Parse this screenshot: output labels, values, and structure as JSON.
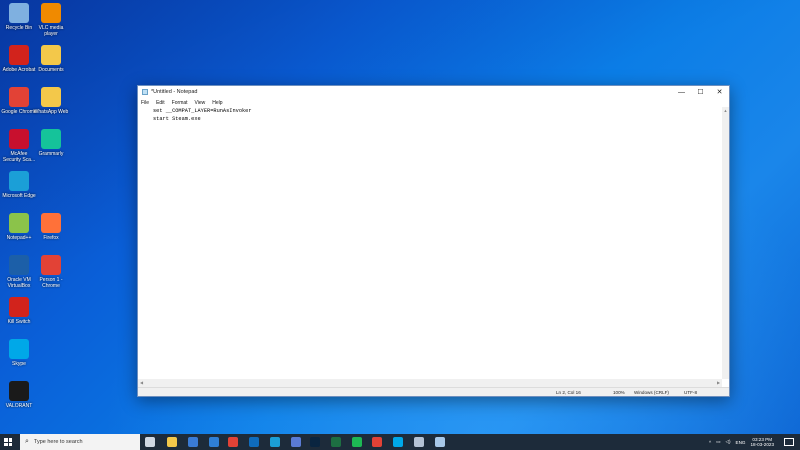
{
  "desktop": {
    "icons": [
      {
        "label": "Recycle Bin",
        "color": "#7fb0e0"
      },
      {
        "label": "VLC media player",
        "color": "#f08a00"
      },
      {
        "label": "Adobe Acrobat",
        "color": "#d2231c"
      },
      {
        "label": "Documents",
        "color": "#f3c84a"
      },
      {
        "label": "Google Chrome",
        "color": "#e24236"
      },
      {
        "label": "WhatsApp Web",
        "color": "#f3c84a"
      },
      {
        "label": "McAfee Security Sca...",
        "color": "#c8102e"
      },
      {
        "label": "Grammarly",
        "color": "#15c39a"
      },
      {
        "label": "Microsoft Edge",
        "color": "#1b9fd7"
      },
      {
        "label": "Notepad++",
        "color": "#8bc34a"
      },
      {
        "label": "Firefox",
        "color": "#ff7139"
      },
      {
        "label": "Oracle VM VirtualBox",
        "color": "#1c5fa8"
      },
      {
        "label": "Person 1 - Chrome",
        "color": "#e24236"
      },
      {
        "label": "Kill Switch",
        "color": "#d2231c"
      },
      {
        "label": "Skype",
        "color": "#00a8e8"
      },
      {
        "label": "VALORANT",
        "color": "#1a1a1a"
      }
    ]
  },
  "notepad": {
    "title": "*Untitled - Notepad",
    "controls": {
      "minimize": "—",
      "maximize": "☐",
      "close": "✕"
    },
    "menu": [
      "File",
      "Edit",
      "Format",
      "View",
      "Help"
    ],
    "content": "set __COMPAT_LAYER=RunAsInvoker\nstart Steam.exe",
    "status": {
      "position": "Ln 2, Col 16",
      "zoom": "100%",
      "line_ending": "Windows (CRLF)",
      "encoding": "UTF-8"
    }
  },
  "taskbar": {
    "search_placeholder": "Type here to search",
    "language": "ENG",
    "time": "03:23 PM",
    "date": "18-03-2023",
    "pinned": [
      {
        "name": "task-view",
        "color": "#cfd8e3"
      },
      {
        "name": "file-explorer",
        "color": "#f3c84a"
      },
      {
        "name": "microsoft-store",
        "color": "#3a7bd5"
      },
      {
        "name": "mail",
        "color": "#2f7fd6"
      },
      {
        "name": "chrome",
        "color": "#e24236"
      },
      {
        "name": "outlook",
        "color": "#0f6cbd"
      },
      {
        "name": "edge",
        "color": "#1b9fd7"
      },
      {
        "name": "microsoft-store-2",
        "color": "#5a7bd5"
      },
      {
        "name": "photoshop",
        "color": "#0a2540"
      },
      {
        "name": "excel",
        "color": "#1d6f42"
      },
      {
        "name": "spotify",
        "color": "#1db954"
      },
      {
        "name": "chrome-2",
        "color": "#e24236"
      },
      {
        "name": "skype",
        "color": "#00a8e8"
      },
      {
        "name": "tools",
        "color": "#b4c2d4"
      },
      {
        "name": "notepad",
        "color": "#a8c8e8"
      }
    ]
  }
}
